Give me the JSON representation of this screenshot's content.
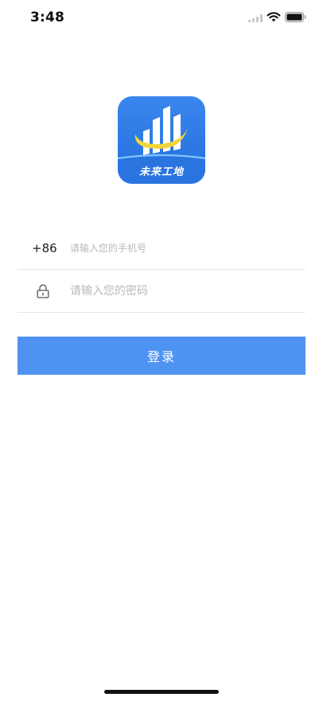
{
  "status_bar": {
    "time": "3:48"
  },
  "logo": {
    "text": "未来工地",
    "colors": {
      "background": "#2d7be6",
      "accent_ring": "#f2d53a"
    }
  },
  "login_form": {
    "phone": {
      "country_code": "+86",
      "value": "",
      "placeholder": "请输入您的手机号"
    },
    "password": {
      "value": "",
      "placeholder": "请输入您的密码",
      "icon": "lock-icon"
    },
    "submit_label": "登录",
    "button_color": "#4f93f2"
  }
}
